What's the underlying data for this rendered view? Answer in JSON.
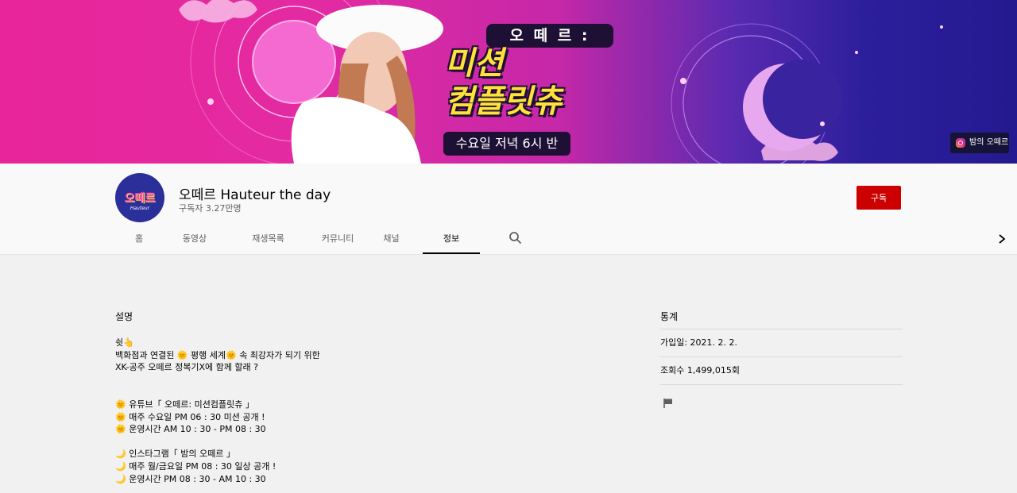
{
  "banner": {
    "logo_top": "오 떼 르 :",
    "logo_main": "미션\n컴플릿츄",
    "logo_sub": "수요일 저녁 6시 반",
    "instagram_label": "밤의 오떼르",
    "colors": {
      "left": "#e8259a",
      "right": "#241a8f",
      "logo_yellow": "#ffe13a"
    }
  },
  "channel": {
    "avatar_text": "오떼르",
    "avatar_sub": "Hauteur",
    "name": "오떼르 Hauteur the day",
    "subscribers": "구독자 3.27만명",
    "subscribe_label": "구독",
    "subscribe_color": "#cc0000"
  },
  "tabs": [
    {
      "label": "홈",
      "active": false
    },
    {
      "label": "동영상",
      "active": false
    },
    {
      "label": "재생목록",
      "active": false
    },
    {
      "label": "커뮤니티",
      "active": false
    },
    {
      "label": "채널",
      "active": false
    },
    {
      "label": "정보",
      "active": true
    }
  ],
  "icons": {
    "search": "search-icon",
    "next": "chevron-right-icon",
    "report": "flag-icon",
    "instagram": "instagram-icon"
  },
  "description": {
    "heading": "설명",
    "body": "쉿👆\n백화점과 연결된 🌞 평행 세계🌞 속 최강자가 되기 위한\nXK-공주 오떼르 정복기X에 함께 할래 ?\n\n\n🌞 유튜브「 오떼르: 미션컴플릿츄 」\n🌞 매주 수요일 PM 06 : 30 미션 공개 !\n🌞 운영시간 AM 10 : 30 - PM 08 : 30\n\n🌙 인스타그램「 밤의 오떼르 」\n🌙 매주 월/금요일 PM 08 : 30 일상 공개 !\n🌙 운영시간 PM 08 : 30 - AM 10 : 30"
  },
  "stats": {
    "heading": "통계",
    "joined": "가입일: 2021. 2. 2.",
    "views": "조회수 1,499,015회"
  }
}
